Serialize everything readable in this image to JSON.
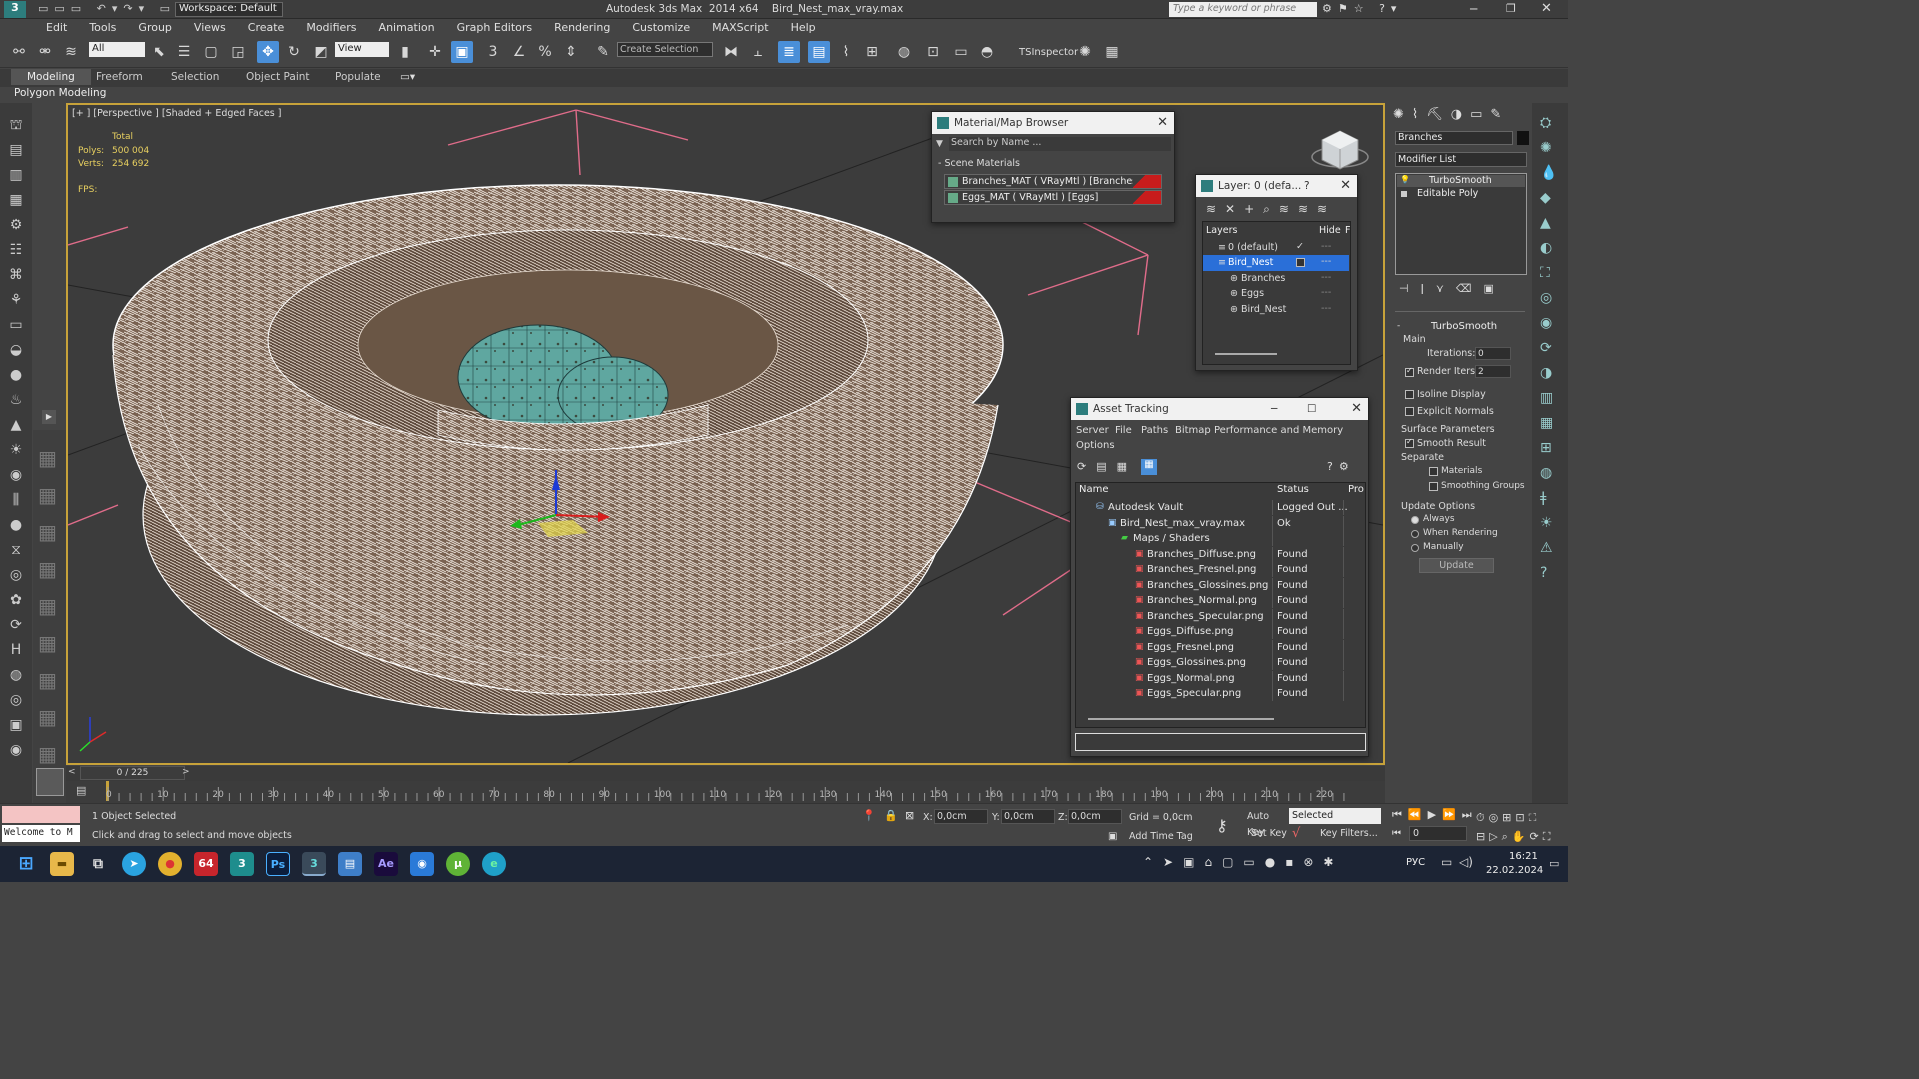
{
  "app": {
    "title": "Autodesk 3ds Max  2014 x64    Bird_Nest_max_vray.max",
    "workspace": "Workspace: Default",
    "search_placeholder": "Type a keyword or phrase"
  },
  "menu": [
    "Edit",
    "Tools",
    "Group",
    "Views",
    "Create",
    "Modifiers",
    "Animation",
    "Graph Editors",
    "Rendering",
    "Customize",
    "MAXScript",
    "Help"
  ],
  "toolbar": {
    "selection_filter": "All",
    "ref_coord": "View",
    "named_selection": "Create Selection Se",
    "tsinspector": "TSInspector"
  },
  "ribbon": {
    "tabs": [
      "Modeling",
      "Freeform",
      "Selection",
      "Object Paint",
      "Populate"
    ],
    "subtitle": "Polygon Modeling"
  },
  "viewport": {
    "label": "[+ ] [Perspective ] [Shaded + Edged Faces ]",
    "stats_header": "Total",
    "polys_label": "Polys:",
    "polys_value": "500 004",
    "verts_label": "Verts:",
    "verts_value": "254 692",
    "fps_label": "FPS:"
  },
  "material_browser": {
    "title": "Material/Map Browser",
    "search_placeholder": "Search by Name ...",
    "group": "- Scene Materials",
    "items": [
      "Branches_MAT  ( VRayMtl ) [Branches]",
      "Eggs_MAT  ( VRayMtl ) [Eggs]"
    ]
  },
  "layer_panel": {
    "title": "Layer: 0 (defa...",
    "col_layers": "Layers",
    "col_hide": "Hide",
    "col_f": "F",
    "rows": [
      "0 (default)",
      "Bird_Nest",
      "Branches",
      "Eggs",
      "Bird_Nest"
    ]
  },
  "asset_tracking": {
    "title": "Asset Tracking",
    "menu": [
      "Server",
      "File",
      "Paths",
      "Bitmap Performance and Memory"
    ],
    "menu2": "Options",
    "col_name": "Name",
    "col_status": "Status",
    "col_pro": "Pro",
    "rows": [
      {
        "name": "Autodesk Vault",
        "status": "Logged Out ..."
      },
      {
        "name": "Bird_Nest_max_vray.max",
        "status": "Ok"
      },
      {
        "name": "Maps / Shaders",
        "status": ""
      },
      {
        "name": "Branches_Diffuse.png",
        "status": "Found"
      },
      {
        "name": "Branches_Fresnel.png",
        "status": "Found"
      },
      {
        "name": "Branches_Glossines.png",
        "status": "Found"
      },
      {
        "name": "Branches_Normal.png",
        "status": "Found"
      },
      {
        "name": "Branches_Specular.png",
        "status": "Found"
      },
      {
        "name": "Eggs_Diffuse.png",
        "status": "Found"
      },
      {
        "name": "Eggs_Fresnel.png",
        "status": "Found"
      },
      {
        "name": "Eggs_Glossines.png",
        "status": "Found"
      },
      {
        "name": "Eggs_Normal.png",
        "status": "Found"
      },
      {
        "name": "Eggs_Specular.png",
        "status": "Found"
      }
    ]
  },
  "command_panel": {
    "object_name": "Branches",
    "modifier_list": "Modifier List",
    "stack": [
      "TurboSmooth",
      "Editable Poly"
    ],
    "rollout_title": "TurboSmooth",
    "main_label": "Main",
    "iterations_label": "Iterations:",
    "iterations_value": "0",
    "render_iters_label": "Render Iters:",
    "render_iters_value": "2",
    "isoline": "Isoline Display",
    "explicit": "Explicit Normals",
    "surface_params": "Surface Parameters",
    "smooth_result": "Smooth Result",
    "separate": "Separate",
    "materials": "Materials",
    "smoothing_groups": "Smoothing Groups",
    "update_options": "Update Options",
    "always": "Always",
    "when_rendering": "When Rendering",
    "manually": "Manually",
    "update_btn": "Update"
  },
  "timeline": {
    "frame": "0 / 225",
    "ticks": [
      "0",
      "10",
      "20",
      "30",
      "40",
      "50",
      "60",
      "70",
      "80",
      "90",
      "100",
      "110",
      "120",
      "130",
      "140",
      "150",
      "160",
      "170",
      "180",
      "190",
      "200",
      "210",
      "220"
    ]
  },
  "status": {
    "script": "Welcome to M",
    "selected": "1 Object Selected",
    "prompt": "Click and drag to select and move objects",
    "x_label": "X:",
    "x_value": "0,0cm",
    "y_label": "Y:",
    "y_value": "0,0cm",
    "z_label": "Z:",
    "z_value": "0,0cm",
    "grid": "Grid = 0,0cm",
    "add_time_tag": "Add Time Tag",
    "auto_key": "Auto Key",
    "selected_dd": "Selected",
    "set_key": "Set Key",
    "key_filters": "Key Filters...",
    "frame_value": "0"
  },
  "taskbar": {
    "lang": "РУС",
    "time": "16:21",
    "date": "22.02.2024"
  }
}
